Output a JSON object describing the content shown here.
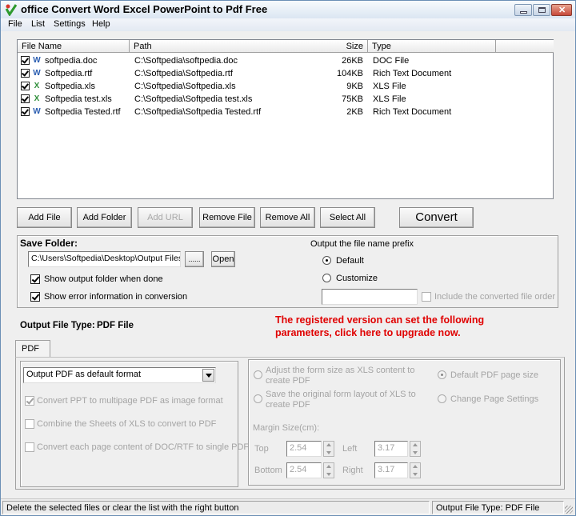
{
  "window": {
    "title": "office Convert Word Excel PowerPoint to Pdf Free",
    "controls": {
      "minimize": "minimize",
      "maximize": "maximize",
      "close": "close"
    }
  },
  "menu": [
    "File",
    "List",
    "Settings",
    "Help"
  ],
  "file_list": {
    "columns": [
      "File Name",
      "Path",
      "Size",
      "Type"
    ],
    "rows": [
      {
        "checked": true,
        "icon": "word-doc-icon",
        "name": "softpedia.doc",
        "path": "C:\\Softpedia\\softpedia.doc",
        "size": "26KB",
        "type": "DOC File"
      },
      {
        "checked": true,
        "icon": "word-doc-icon",
        "name": "Softpedia.rtf",
        "path": "C:\\Softpedia\\Softpedia.rtf",
        "size": "104KB",
        "type": "Rich Text Document"
      },
      {
        "checked": true,
        "icon": "excel-xls-icon",
        "name": "Softpedia.xls",
        "path": "C:\\Softpedia\\Softpedia.xls",
        "size": "9KB",
        "type": "XLS File"
      },
      {
        "checked": true,
        "icon": "excel-xls-icon",
        "name": "Softpedia test.xls",
        "path": "C:\\Softpedia\\Softpedia test.xls",
        "size": "75KB",
        "type": "XLS File"
      },
      {
        "checked": true,
        "icon": "word-doc-icon",
        "name": "Softpedia Tested.rtf",
        "path": "C:\\Softpedia\\Softpedia Tested.rtf",
        "size": "2KB",
        "type": "Rich Text Document"
      }
    ]
  },
  "buttons": {
    "add_file": "Add File",
    "add_folder": "Add Folder",
    "add_url": "Add URL",
    "remove_file": "Remove File",
    "remove_all": "Remove All",
    "select_all": "Select All",
    "convert": "Convert"
  },
  "save_folder": {
    "label": "Save Folder:",
    "path": "C:\\Users\\Softpedia\\Desktop\\Output Files",
    "browse_label": "......",
    "open_label": "Open",
    "show_output_folder": {
      "label": "Show output folder when done",
      "checked": true
    },
    "show_error_info": {
      "label": "Show error information in conversion",
      "checked": true
    }
  },
  "prefix": {
    "label": "Output the file name prefix",
    "default_label": "Default",
    "customize_label": "Customize",
    "selected": "Default",
    "custom_value": "",
    "include_order": {
      "label": "Include the converted file order",
      "checked": false
    }
  },
  "output_type": {
    "label": "Output File Type:",
    "value": "PDF File"
  },
  "upgrade_notice": {
    "line1": "The registered version can set the following",
    "line2": "parameters, click here to upgrade now.",
    "color": "#e00000"
  },
  "tabs": [
    {
      "label": "PDF",
      "active": true
    }
  ],
  "pdf_options": {
    "format_select": "Output PDF as default format",
    "ppt_multipage": {
      "label": "Convert PPT to multipage PDF as image format",
      "checked": true
    },
    "combine_sheets": {
      "label": "Combine the Sheets of XLS to convert to PDF",
      "checked": false
    },
    "each_page_single": {
      "label": "Convert each page content of DOC/RTF to single PDF",
      "checked": false
    }
  },
  "xls_options": {
    "adjust_form": {
      "line1": "Adjust the form size as XLS content to",
      "line2": "create PDF",
      "selected": false
    },
    "save_original": {
      "line1": "Save the original form layout of XLS to",
      "line2": "create PDF",
      "selected": false
    },
    "default_page_size": {
      "label": "Default PDF page size",
      "selected": true
    },
    "change_page_settings": {
      "label": "Change Page Settings",
      "selected": false
    },
    "margin_label": "Margin Size(cm):",
    "margins": {
      "top": {
        "label": "Top",
        "value": "2.54"
      },
      "bottom": {
        "label": "Bottom",
        "value": "2.54"
      },
      "left": {
        "label": "Left",
        "value": "3.17"
      },
      "right": {
        "label": "Right",
        "value": "3.17"
      }
    }
  },
  "status": {
    "message": "Delete the selected files or clear the list with the right button",
    "output_type": "Output File Type:  PDF File"
  }
}
